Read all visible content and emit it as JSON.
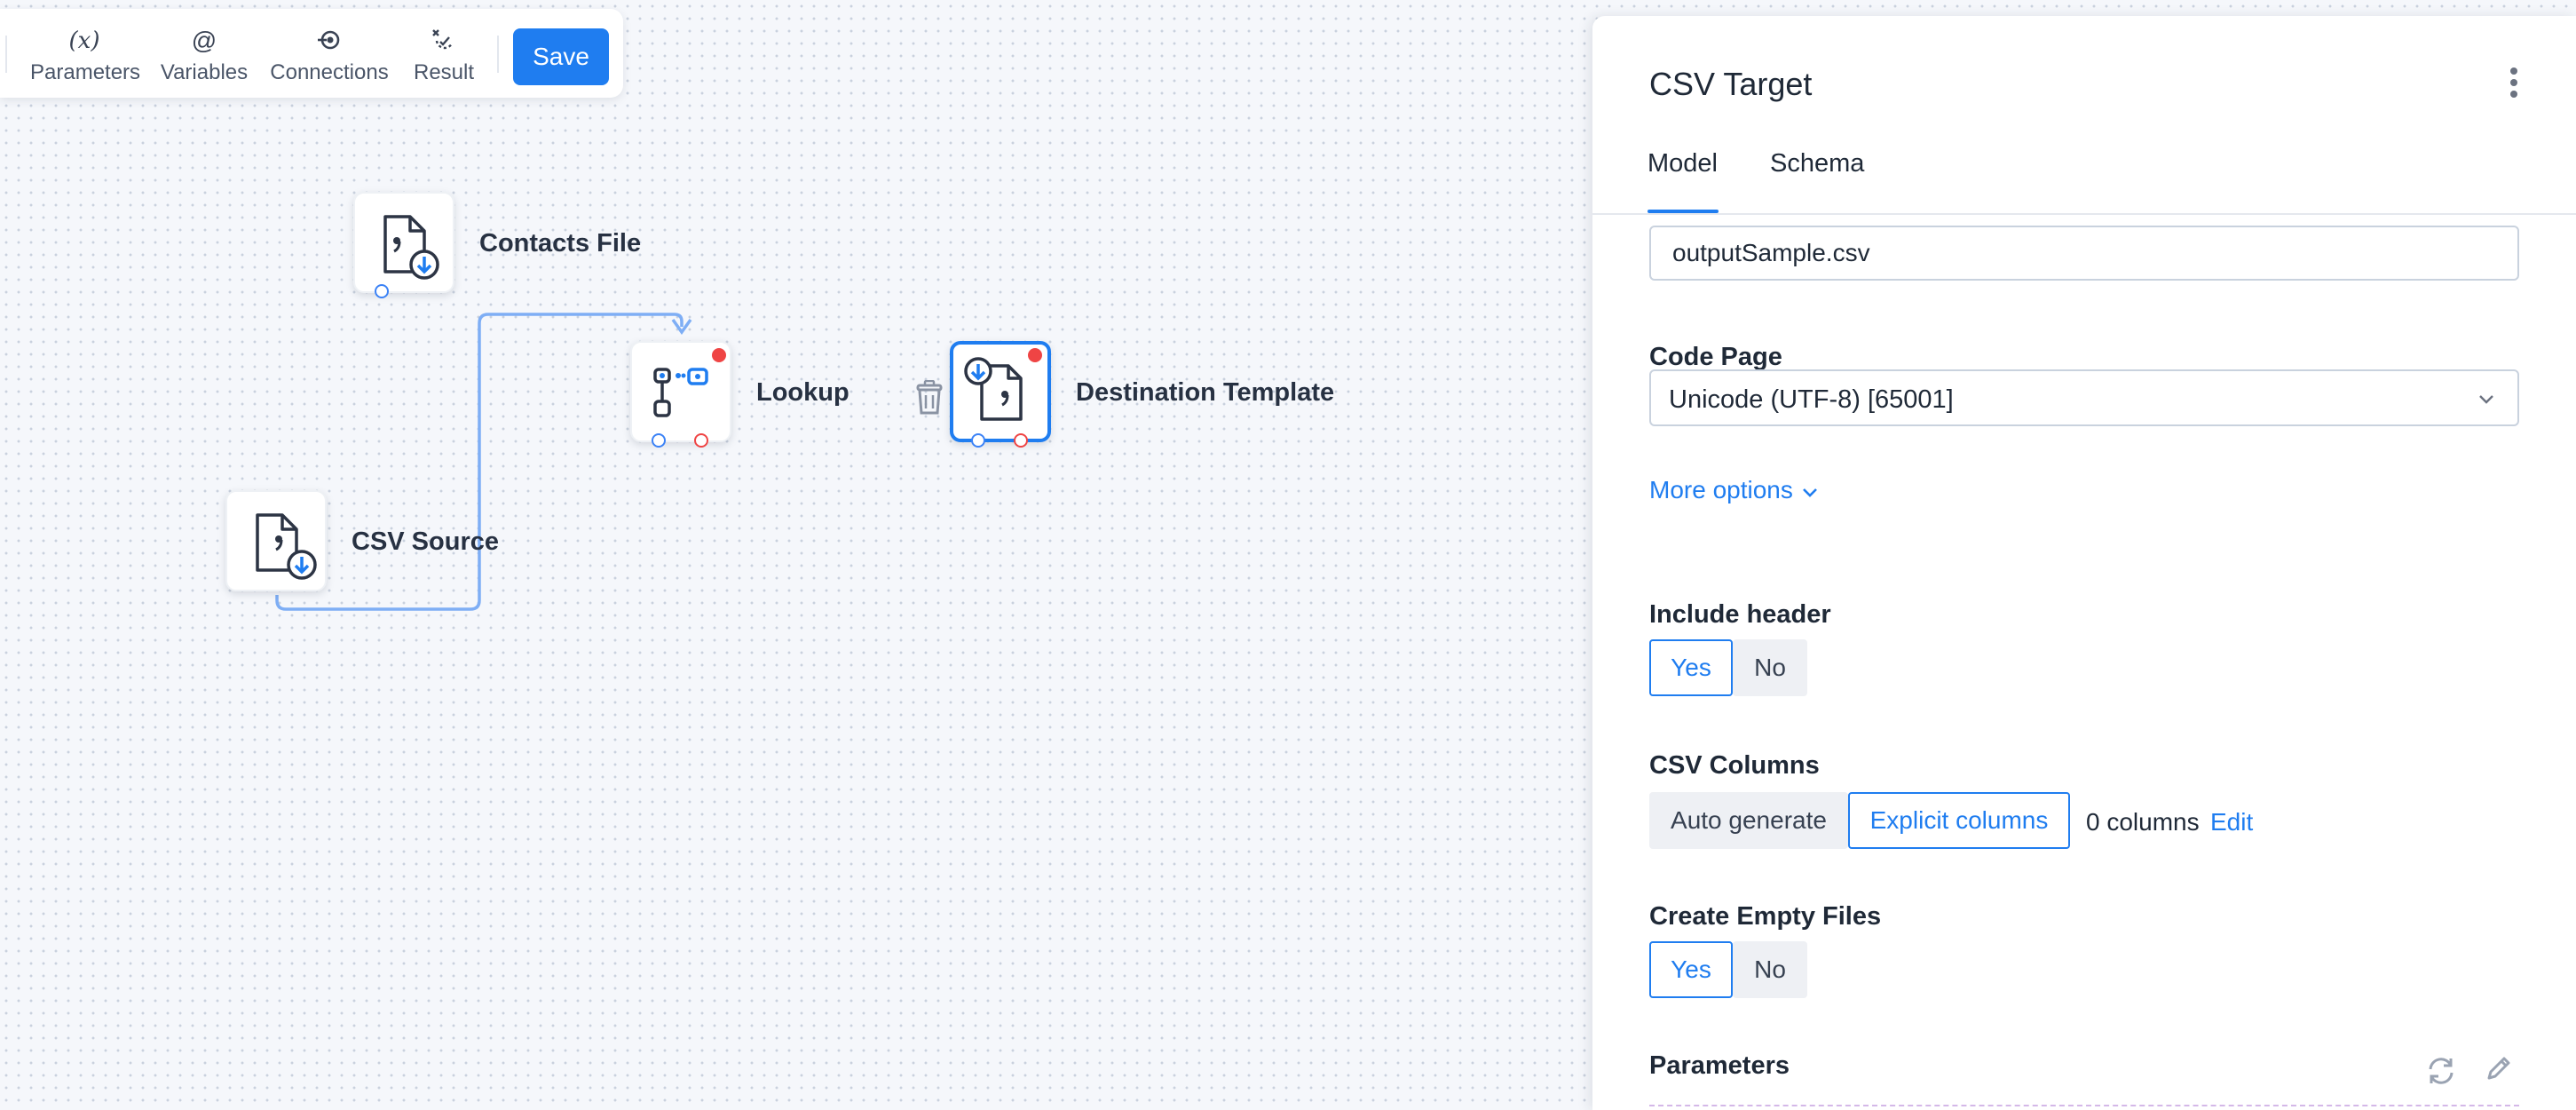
{
  "toolbar": {
    "items": [
      {
        "icon": "(x)",
        "label": "Parameters"
      },
      {
        "icon": "@",
        "label": "Variables"
      },
      {
        "icon": "connections-icon",
        "label": "Connections"
      },
      {
        "icon": "result-icon",
        "label": "Result"
      }
    ],
    "save_label": "Save"
  },
  "canvas": {
    "nodes": [
      {
        "id": "contacts-file",
        "label": "Contacts File"
      },
      {
        "id": "lookup",
        "label": "Lookup"
      },
      {
        "id": "destination-template",
        "label": "Destination Template"
      },
      {
        "id": "csv-source",
        "label": "CSV Source"
      }
    ]
  },
  "panel": {
    "title": "CSV Target",
    "tabs": [
      "Model",
      "Schema"
    ],
    "active_tab": "Model",
    "file_name": "outputSample.csv",
    "code_page_label": "Code Page",
    "code_page_value": "Unicode (UTF-8) [65001]",
    "more_options": "More options",
    "include_header": {
      "label": "Include header",
      "yes": "Yes",
      "no": "No",
      "selected": "Yes"
    },
    "csv_columns": {
      "label": "CSV Columns",
      "auto": "Auto generate",
      "explicit": "Explicit columns",
      "selected": "Explicit columns",
      "count": "0 columns",
      "edit": "Edit"
    },
    "create_empty_files": {
      "label": "Create Empty Files",
      "yes": "Yes",
      "no": "No",
      "selected": "Yes"
    },
    "parameters_label": "Parameters"
  },
  "colors": {
    "accent": "#1f7df0",
    "error": "#ef4444",
    "canvas_bg": "#f5f7fb"
  }
}
